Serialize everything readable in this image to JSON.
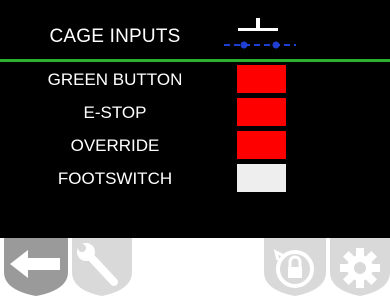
{
  "header": {
    "title": "CAGE INPUTS",
    "icon": "switch-icon"
  },
  "inputs": [
    {
      "label": "GREEN BUTTON",
      "state": "active",
      "color": "#ff0000"
    },
    {
      "label": "E-STOP",
      "state": "active",
      "color": "#ff0000"
    },
    {
      "label": "OVERRIDE",
      "state": "active",
      "color": "#ff0000"
    },
    {
      "label": "FOOTSWITCH",
      "state": "inactive",
      "color": "#eeeeee"
    }
  ],
  "toolbar": {
    "back": {
      "icon": "back-arrow-icon",
      "enabled": true
    },
    "settings": {
      "icon": "wrench-icon",
      "enabled": false
    },
    "unlock": {
      "icon": "lock-icon",
      "enabled": false
    },
    "config": {
      "icon": "gear-icon",
      "enabled": false
    }
  },
  "colors": {
    "accent_line": "#2bb12b",
    "switch_blue": "#1f3fd4",
    "active": "#ff0000",
    "inactive": "#eeeeee"
  }
}
